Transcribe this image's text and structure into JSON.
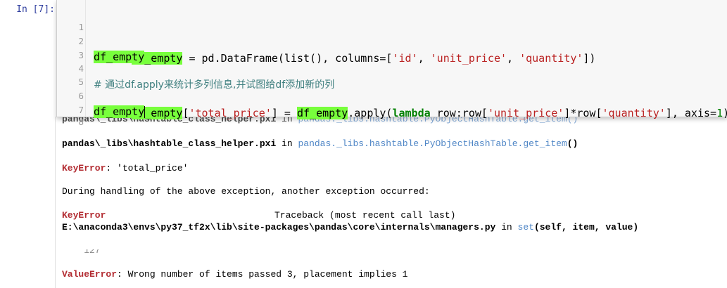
{
  "prompt": "In  [7]:",
  "code_lines": [
    {
      "n": "1",
      "a": "df_empty",
      "b": " = pd.DataFrame(list(), columns=[",
      "s1": "'id'",
      "c": ", ",
      "s2": "'unit_price'",
      "d": ", ",
      "s3": "'quantity'",
      "e": "])"
    },
    {
      "n": "2",
      "a": "df_empty"
    },
    {
      "n": "3"
    },
    {
      "n": "4",
      "comment": "# 通过df.apply来统计多列信息,并试图给df添加新的列"
    },
    {
      "n": "5",
      "a": "df_empty",
      "p1": "[",
      "s1": "'total_price'",
      "p2": "] = ",
      "a2": "df_empty",
      "p3": ".apply(",
      "kw": "lambda",
      "p4": " row:row[",
      "s2": "'unit_price'",
      "p5": "]*row[",
      "s3": "'quantity'",
      "p6": "], axis=",
      "num": "1",
      "p7": ")"
    },
    {
      "n": "6",
      "a": "df_empty"
    },
    {
      "n": "7"
    },
    {
      "n": "8"
    }
  ],
  "output": {
    "partial_top_path": "pandas\\_libs\\hashtable_class_helper.pxi",
    "partial_top_in": " in ",
    "partial_top_fn": "pandas._libs.hashtable.PyObjectHashTable.get_item()",
    "line1_path": "pandas\\_libs\\hashtable_class_helper.pxi",
    "line1_in": " in ",
    "line1_fn": "pandas._libs.hashtable.PyObjectHashTable.get_item",
    "line1_paren": "()",
    "keyerror_name": "KeyError",
    "keyerror_msg": ": 'total_price'",
    "during": "During handling of the above exception, another exception occurred:",
    "tb_name": "KeyError",
    "tb_text": "Traceback (most recent call last)",
    "mgr_path": "E:\\anaconda3\\envs\\py37_tf2x\\lib\\site-packages\\pandas\\core\\internals\\managers.py",
    "mgr_in": " in ",
    "mgr_fn": "set",
    "mgr_args": "(self, item, value)",
    "partial_127": "    127",
    "partial_paren": ")",
    "valueerror_name": "ValueError",
    "valueerror_msg": ": Wrong number of items passed 3, placement implies 1"
  }
}
